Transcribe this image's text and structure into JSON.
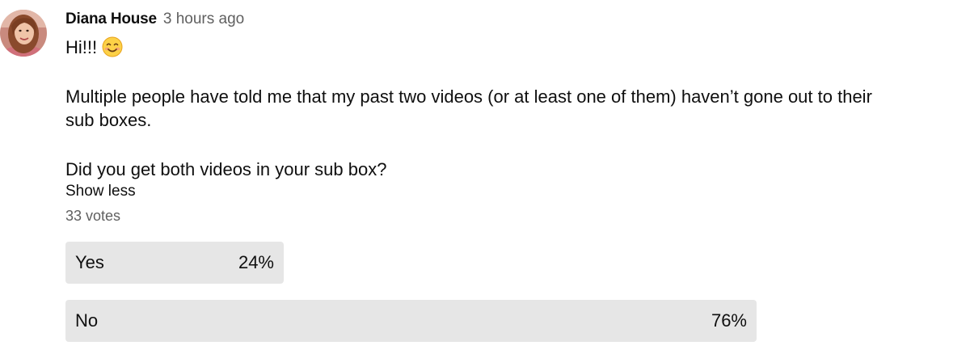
{
  "post": {
    "author": "Diana House",
    "timestamp": "3 hours ago",
    "greeting": "Hi!!!",
    "greeting_emoji": "smiling-face-icon",
    "paragraph1_line1": "Multiple people have told me that my past two videos (or at least one of them) haven’t gone out to their",
    "paragraph1_line2": "sub boxes.",
    "question": "Did you get both videos in your sub box?",
    "show_less_label": "Show less"
  },
  "poll": {
    "votes_label": "33 votes",
    "options": [
      {
        "label": "Yes",
        "percent_label": "24%",
        "percent": 24
      },
      {
        "label": "No",
        "percent_label": "76%",
        "percent": 76
      }
    ],
    "bar_color": "#e6e6e6"
  },
  "colors": {
    "text_primary": "#0f0f0f",
    "text_secondary": "#606060"
  }
}
